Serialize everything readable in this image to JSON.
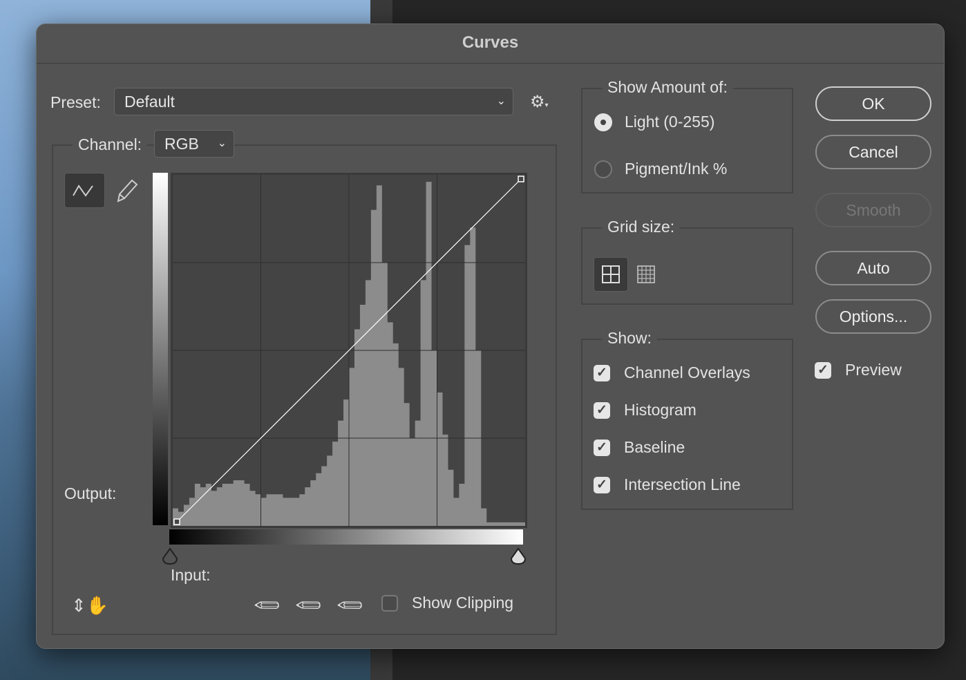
{
  "dialog": {
    "title": "Curves"
  },
  "preset": {
    "label": "Preset:",
    "value": "Default"
  },
  "channel": {
    "label": "Channel:",
    "value": "RGB"
  },
  "graph": {
    "output_label": "Output:",
    "input_label": "Input:",
    "histogram": [
      0.05,
      0.04,
      0.06,
      0.08,
      0.12,
      0.11,
      0.12,
      0.1,
      0.11,
      0.12,
      0.12,
      0.13,
      0.13,
      0.12,
      0.1,
      0.09,
      0.08,
      0.09,
      0.09,
      0.09,
      0.08,
      0.08,
      0.08,
      0.09,
      0.11,
      0.13,
      0.15,
      0.17,
      0.2,
      0.24,
      0.3,
      0.36,
      0.45,
      0.56,
      0.63,
      0.7,
      0.9,
      0.97,
      0.75,
      0.58,
      0.52,
      0.45,
      0.35,
      0.25,
      0.3,
      0.7,
      0.98,
      0.5,
      0.38,
      0.26,
      0.16,
      0.08,
      0.12,
      0.8,
      0.85,
      0.5,
      0.05,
      0.01,
      0.01,
      0.01,
      0.01,
      0.01,
      0.01,
      0.01
    ],
    "curve_points": [
      [
        0,
        0
      ],
      [
        255,
        255
      ]
    ]
  },
  "bottom": {
    "show_clipping_label": "Show Clipping",
    "show_clipping": false
  },
  "show_amount": {
    "title": "Show Amount of:",
    "options": [
      {
        "label": "Light  (0-255)",
        "selected": true
      },
      {
        "label": "Pigment/Ink %",
        "selected": false
      }
    ]
  },
  "grid_size": {
    "title": "Grid size:",
    "selected": "simple"
  },
  "show": {
    "title": "Show:",
    "items": [
      {
        "label": "Channel Overlays",
        "checked": true
      },
      {
        "label": "Histogram",
        "checked": true
      },
      {
        "label": "Baseline",
        "checked": true
      },
      {
        "label": "Intersection Line",
        "checked": true
      }
    ]
  },
  "buttons": {
    "ok": "OK",
    "cancel": "Cancel",
    "smooth": "Smooth",
    "auto": "Auto",
    "options": "Options...",
    "preview": "Preview"
  },
  "preview_checked": true
}
